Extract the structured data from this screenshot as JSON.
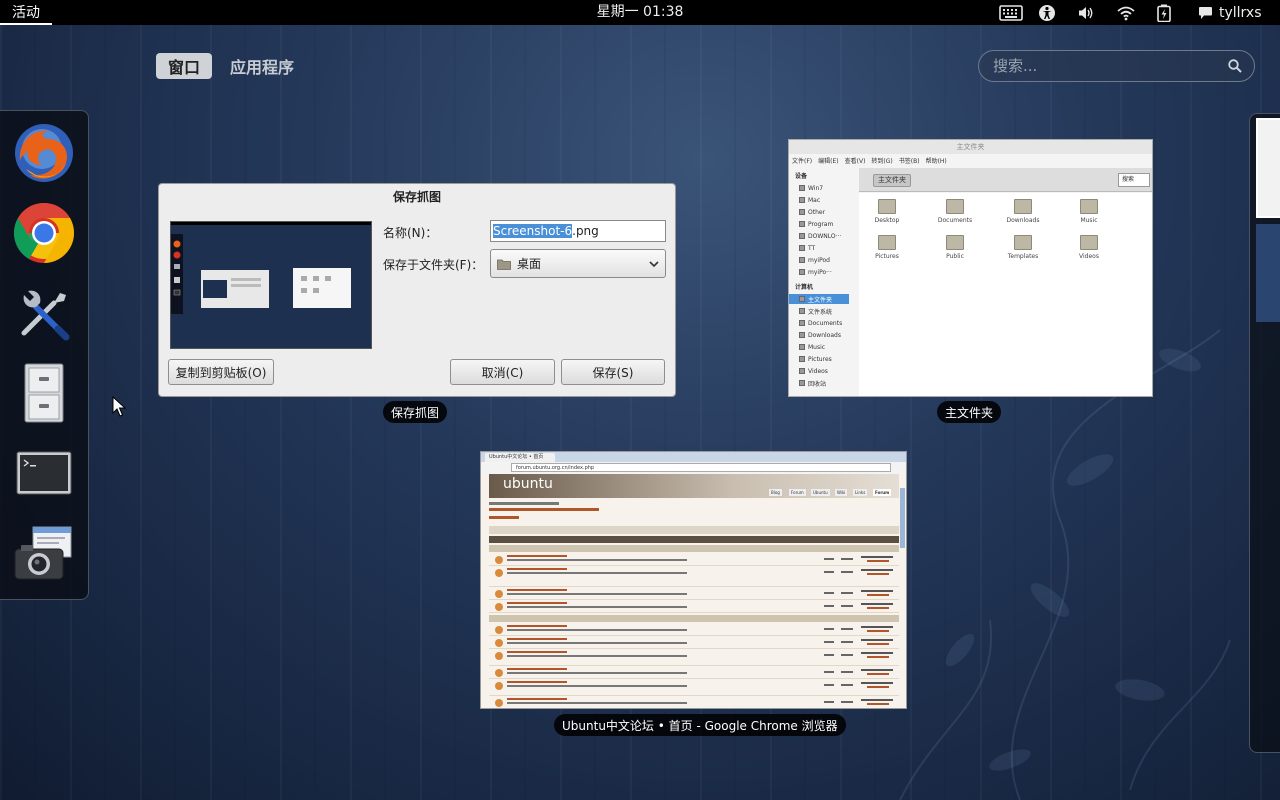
{
  "top_bar": {
    "activities": "活动",
    "clock": "星期一 01:38",
    "user": "tyllrxs"
  },
  "overview": {
    "tabs": [
      {
        "label": "窗口",
        "active": true
      },
      {
        "label": "应用程序",
        "active": false
      }
    ],
    "search_placeholder": "搜索..."
  },
  "dash": {
    "apps": [
      {
        "name": "firefox-icon"
      },
      {
        "name": "chrome-icon"
      },
      {
        "name": "system-settings-icon"
      },
      {
        "name": "file-cabinet-icon"
      },
      {
        "name": "terminal-icon"
      },
      {
        "name": "screenshot-camera-icon"
      }
    ]
  },
  "windows": {
    "save_dialog": {
      "caption": "保存抓图",
      "title": "保存抓图",
      "name_label": "名称(N)：",
      "name_selected": "Screenshot-6",
      "name_suffix": ".png",
      "folder_label": "保存于文件夹(F)：",
      "folder_value": "桌面",
      "copy_button": "复制到剪贴板(O)",
      "cancel_button": "取消(C)",
      "save_button": "保存(S)"
    },
    "file_manager": {
      "caption": "主文件夹",
      "title": "主文件夹",
      "menu": [
        "文件(F)",
        "编辑(E)",
        "查看(V)",
        "转到(G)",
        "书签(B)",
        "帮助(H)"
      ],
      "sidebar_devices_header": "设备",
      "devices": [
        "Win7",
        "Mac",
        "Other",
        "Program",
        "DOWNLO···",
        "TT",
        "myiPod",
        "myiPo···"
      ],
      "sidebar_computer_header": "计算机",
      "places": [
        "主文件夹",
        "文件系统",
        "Documents",
        "Downloads",
        "Music",
        "Pictures",
        "Videos",
        "回收站"
      ],
      "path_button": "主文件夹",
      "search_button": "搜索",
      "files": [
        "Desktop",
        "Documents",
        "Downloads",
        "Music",
        "Pictures",
        "Public",
        "Templates",
        "Videos"
      ]
    },
    "chrome": {
      "caption": "Ubuntu中文论坛 • 首页 - Google Chrome 浏览器",
      "tab_title": "Ubuntu中文论坛 • 首页",
      "url": "forum.ubuntu.org.cn/index.php",
      "logo": "ubuntu",
      "nav": [
        "Blog",
        "Forum",
        "Ubuntu",
        "Wiki",
        "Links",
        "Forum"
      ]
    }
  }
}
